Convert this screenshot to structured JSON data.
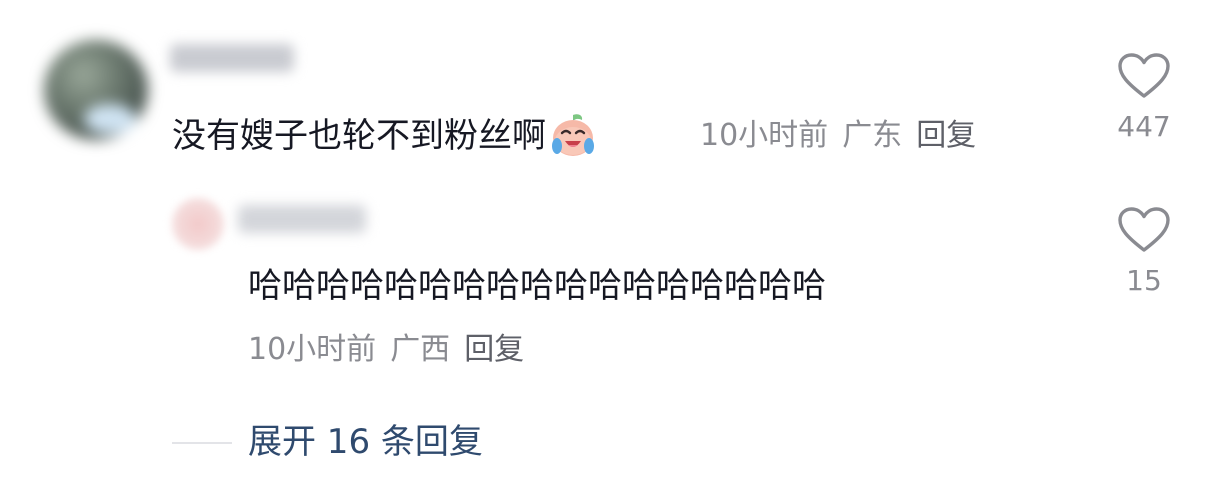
{
  "comment": {
    "text": "没有嫂子也轮不到粉丝啊",
    "emoji": "crying-laughing-peach-emoji",
    "time": "10小时前",
    "location": "广东",
    "reply_label": "回复",
    "like_count": "447"
  },
  "reply": {
    "text": "哈哈哈哈哈哈哈哈哈哈哈哈哈哈哈哈哈",
    "time": "10小时前",
    "location": "广西",
    "reply_label": "回复",
    "like_count": "15"
  },
  "expand": {
    "label": "展开 16 条回复"
  },
  "colors": {
    "text": "#161823",
    "meta": "#8a8b91",
    "expand": "#2f4a6e"
  },
  "icons": {
    "like": "heart-outline-icon"
  }
}
